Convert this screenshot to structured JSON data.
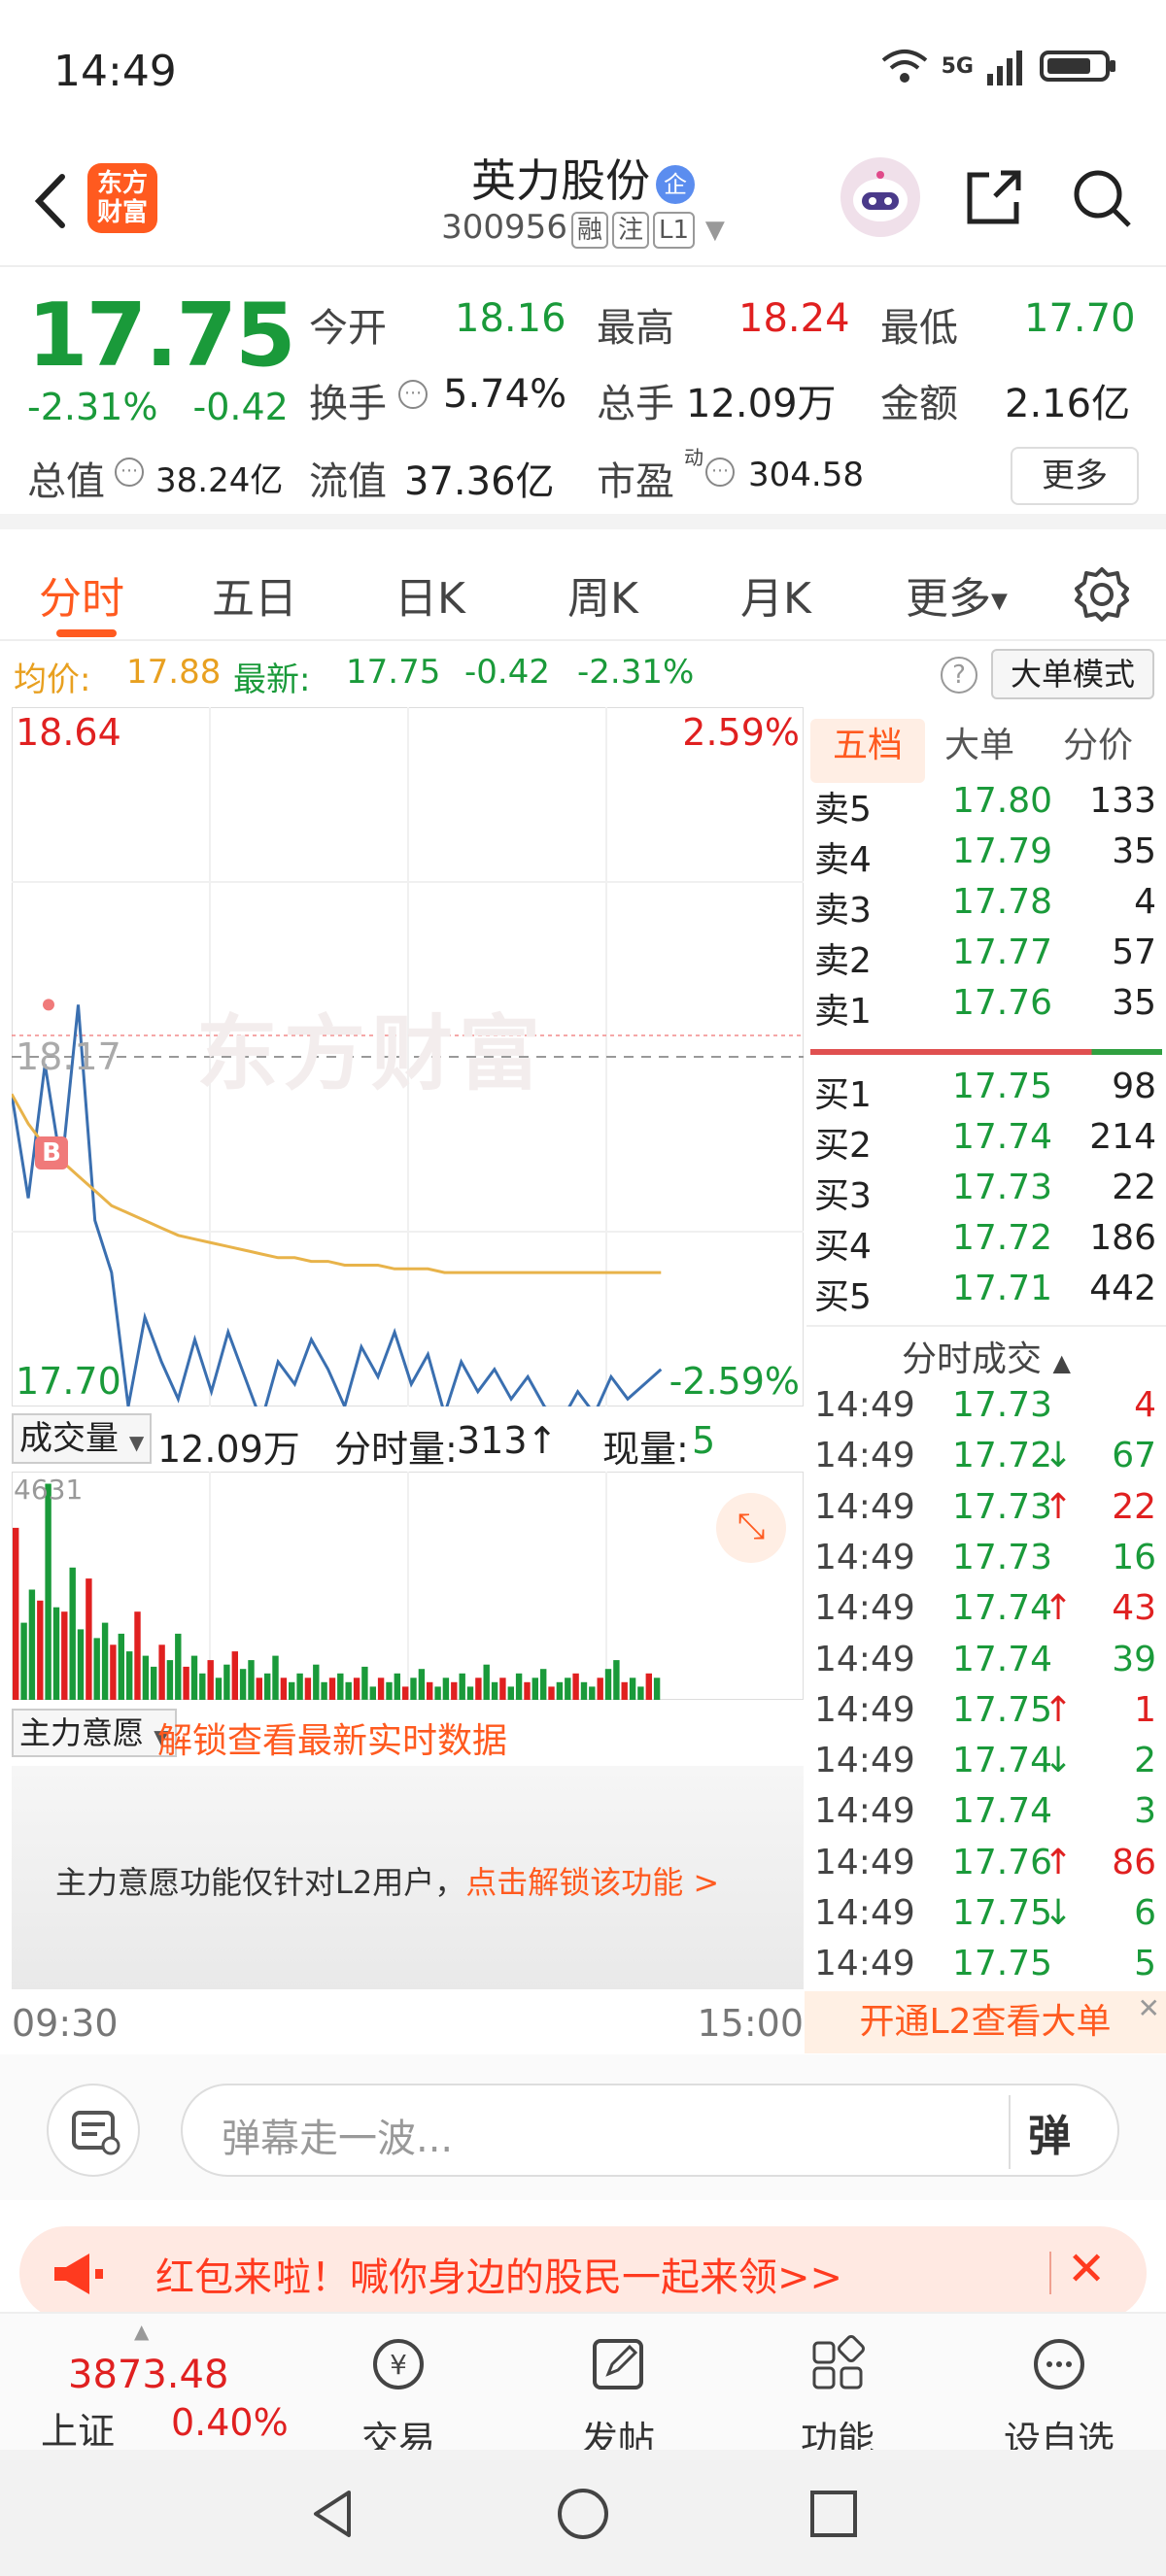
{
  "status": {
    "time": "14:49",
    "network": "5G"
  },
  "header": {
    "logo_text": "东方财富",
    "stock_name": "英力股份",
    "name_badge": "企",
    "stock_code": "300956",
    "tags": [
      "融",
      "注",
      "L1"
    ]
  },
  "quote": {
    "price": "17.75",
    "change_pct": "-2.31%",
    "change_abs": "-0.42",
    "fields": [
      {
        "label": "今开",
        "value": "18.16",
        "color": "#1a9a3a"
      },
      {
        "label": "最高",
        "value": "18.24",
        "color": "#e02020"
      },
      {
        "label": "最低",
        "value": "17.70",
        "color": "#1a9a3a"
      },
      {
        "label": "换手",
        "value": "5.74%",
        "color": "#222222"
      },
      {
        "label": "总手",
        "value": "12.09万",
        "color": "#222222"
      },
      {
        "label": "金额",
        "value": "2.16亿",
        "color": "#222222"
      },
      {
        "label": "总值",
        "value": "38.24亿",
        "color": "#222222"
      },
      {
        "label": "流值",
        "value": "37.36亿",
        "color": "#222222"
      },
      {
        "label": "市盈",
        "value": "304.58",
        "color": "#222222",
        "superscript": "动"
      }
    ],
    "more_label": "更多"
  },
  "tabs": {
    "items": [
      "分时",
      "五日",
      "日K",
      "周K",
      "月K",
      "更多"
    ],
    "active": "分时"
  },
  "avgbar": {
    "avg_label": "均价:",
    "avg_value": "17.88",
    "latest_label": "最新:",
    "latest_value": "17.75",
    "latest_chg": "-0.42",
    "latest_pct": "-2.31%",
    "help": "?",
    "mode_button": "大单模式"
  },
  "chart_data": {
    "type": "line",
    "y_high": "18.64",
    "y_high_pct": "2.59%",
    "y_low": "17.70",
    "y_low_pct": "-2.59%",
    "prev_close": "18.17",
    "watermark": "东方财富",
    "marker": "B",
    "series": [
      {
        "values": [
          18.12,
          17.98,
          18.16,
          18.02,
          18.24,
          17.95,
          17.88,
          17.7,
          17.82,
          17.76,
          17.71,
          17.79,
          17.72,
          17.8,
          17.74,
          17.68,
          17.76,
          17.73,
          17.79,
          17.75,
          17.7,
          17.78,
          17.74,
          17.8,
          17.73,
          17.77,
          17.69,
          17.76,
          17.72,
          17.75,
          17.71,
          17.74,
          17.7,
          17.68,
          17.72,
          17.69,
          17.74,
          17.71,
          17.73,
          17.75
        ]
      },
      {
        "values": [
          18.12,
          18.08,
          18.05,
          18.03,
          18.01,
          17.99,
          17.97,
          17.96,
          17.95,
          17.94,
          17.93,
          17.925,
          17.92,
          17.915,
          17.91,
          17.905,
          17.9,
          17.9,
          17.895,
          17.895,
          17.89,
          17.89,
          17.89,
          17.885,
          17.885,
          17.885,
          17.88,
          17.88,
          17.88,
          17.88,
          17.88,
          17.88,
          17.88,
          17.88,
          17.88,
          17.88,
          17.88,
          17.88,
          17.88,
          17.88
        ]
      }
    ],
    "ylim": [
      17.7,
      18.64
    ]
  },
  "side": {
    "tabs": [
      "五档",
      "大单",
      "分价"
    ],
    "asks": [
      {
        "label": "卖5",
        "price": "17.80",
        "vol": "133"
      },
      {
        "label": "卖4",
        "price": "17.79",
        "vol": "35"
      },
      {
        "label": "卖3",
        "price": "17.78",
        "vol": "4"
      },
      {
        "label": "卖2",
        "price": "17.77",
        "vol": "57"
      },
      {
        "label": "卖1",
        "price": "17.76",
        "vol": "35"
      }
    ],
    "bids": [
      {
        "label": "买1",
        "price": "17.75",
        "vol": "98"
      },
      {
        "label": "买2",
        "price": "17.74",
        "vol": "214"
      },
      {
        "label": "买3",
        "price": "17.73",
        "vol": "22"
      },
      {
        "label": "买4",
        "price": "17.72",
        "vol": "186"
      },
      {
        "label": "买5",
        "price": "17.71",
        "vol": "442"
      }
    ],
    "ticks_title": "分时成交",
    "ticks": [
      {
        "time": "14:49",
        "price": "17.73",
        "arrow": "",
        "vol": "4",
        "vcolor": "#e02020"
      },
      {
        "time": "14:49",
        "price": "17.72",
        "arrow": "↓",
        "vol": "67",
        "vcolor": "#1a9a3a"
      },
      {
        "time": "14:49",
        "price": "17.73",
        "arrow": "↑",
        "vol": "22",
        "vcolor": "#e02020"
      },
      {
        "time": "14:49",
        "price": "17.73",
        "arrow": "",
        "vol": "16",
        "vcolor": "#1a9a3a"
      },
      {
        "time": "14:49",
        "price": "17.74",
        "arrow": "↑",
        "vol": "43",
        "vcolor": "#e02020"
      },
      {
        "time": "14:49",
        "price": "17.74",
        "arrow": "",
        "vol": "39",
        "vcolor": "#1a9a3a"
      },
      {
        "time": "14:49",
        "price": "17.75",
        "arrow": "↑",
        "vol": "1",
        "vcolor": "#e02020"
      },
      {
        "time": "14:49",
        "price": "17.74",
        "arrow": "↓",
        "vol": "2",
        "vcolor": "#1a9a3a"
      },
      {
        "time": "14:49",
        "price": "17.74",
        "arrow": "",
        "vol": "3",
        "vcolor": "#1a9a3a"
      },
      {
        "time": "14:49",
        "price": "17.76",
        "arrow": "↑",
        "vol": "86",
        "vcolor": "#e02020"
      },
      {
        "time": "14:49",
        "price": "17.75",
        "arrow": "↓",
        "vol": "6",
        "vcolor": "#1a9a3a"
      },
      {
        "time": "14:49",
        "price": "17.75",
        "arrow": "",
        "vol": "5",
        "vcolor": "#1a9a3a"
      }
    ],
    "l2_banner": "开通L2查看大单"
  },
  "volume": {
    "selector": "成交量",
    "total": "12.09万",
    "interval_label": "分时量:",
    "interval_value": "313",
    "interval_arrow": "↑",
    "now_label": "现量:",
    "now_value": "5",
    "ymax_label": "4631",
    "bars": [
      0.78,
      0.35,
      0.5,
      0.45,
      0.98,
      0.42,
      0.4,
      0.6,
      0.32,
      0.55,
      0.28,
      0.35,
      0.25,
      0.3,
      0.22,
      0.4,
      0.2,
      0.15,
      0.25,
      0.18,
      0.3,
      0.15,
      0.2,
      0.12,
      0.18,
      0.1,
      0.16,
      0.22,
      0.14,
      0.18,
      0.1,
      0.12,
      0.2,
      0.1,
      0.08,
      0.12,
      0.1,
      0.16,
      0.08,
      0.1,
      0.12,
      0.08,
      0.1,
      0.15,
      0.06,
      0.1,
      0.08,
      0.12,
      0.06,
      0.1,
      0.14,
      0.08,
      0.06,
      0.1,
      0.08,
      0.12,
      0.06,
      0.1,
      0.16,
      0.08,
      0.1,
      0.06,
      0.12,
      0.08,
      0.1,
      0.14,
      0.06,
      0.08,
      0.1,
      0.12,
      0.08,
      0.06,
      0.1,
      0.14,
      0.18,
      0.08,
      0.1,
      0.06,
      0.12,
      0.1
    ]
  },
  "main_force": {
    "selector": "主力意愿",
    "unlock_link": "解锁查看最新实时数据",
    "notice": "主力意愿功能仅针对L2用户，",
    "notice_link": "点击解锁该功能 >"
  },
  "time_axis": {
    "start": "09:30",
    "end": "15:00"
  },
  "danmu": {
    "placeholder": "弹幕走一波...",
    "button": "弹"
  },
  "redpack": {
    "text": "红包来啦！喊你身边的股民一起来领>>"
  },
  "bottombar": {
    "index_value": "3873.48",
    "index_name": "上证",
    "index_pct": "0.40%",
    "items": [
      "交易",
      "发帖",
      "功能",
      "设自选"
    ]
  },
  "colors": {
    "accent": "#ff5a1f",
    "up": "#e02020",
    "down": "#1a9a3a",
    "price_line": "#3a6fb0",
    "avg_line": "#e8b34a"
  }
}
